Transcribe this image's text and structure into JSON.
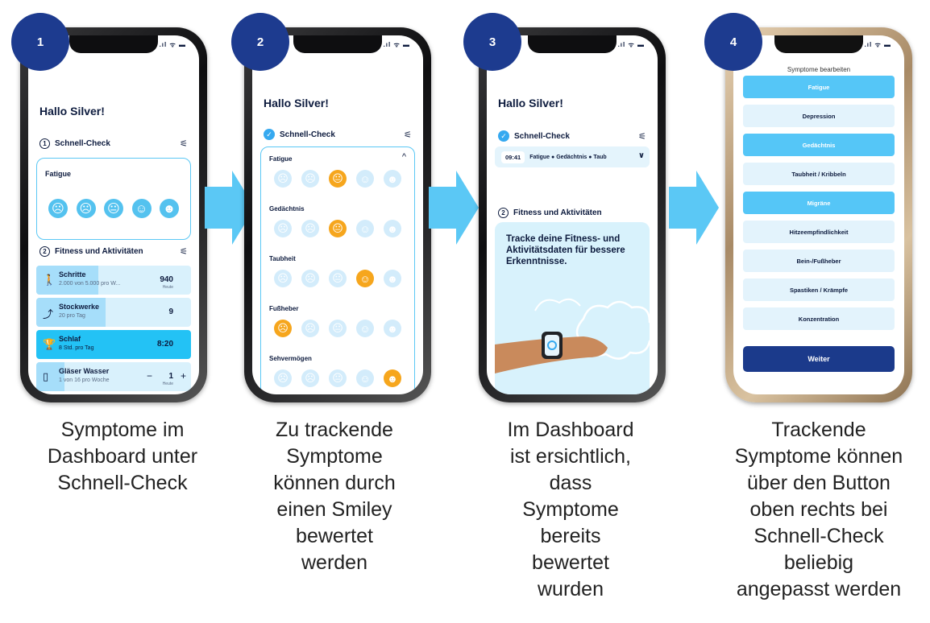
{
  "steps": [
    {
      "number": "1",
      "caption": "Symptome im\nDashboard unter\nSchnell-Check"
    },
    {
      "number": "2",
      "caption": "Zu trackende\nSymptome\nkönnen durch\neinen Smiley\nbewertet\nwerden"
    },
    {
      "number": "3",
      "caption": "Im Dashboard\nist ersichtlich,\ndass\nSymptome\nbereits\nbewertet\nwurden"
    },
    {
      "number": "4",
      "caption": "Trackende\nSymptome können\nüber den Button\noben rechts bei\nSchnell-Check\nbeliebig\nangepasst werden"
    }
  ],
  "phone1": {
    "greeting": "Hallo Silver!",
    "quick_check_title": "Schnell-Check",
    "symptom_label": "Fatigue",
    "activities_title": "Fitness und Aktivitäten",
    "activities": [
      {
        "title": "Schritte",
        "subtitle": "2.000 von 5.000 pro W...",
        "value": "940",
        "hint": "Heute",
        "icon": "walking-icon",
        "progress": 0.4
      },
      {
        "title": "Stockwerke",
        "subtitle": "20 pro Tag",
        "value": "9",
        "hint": "",
        "icon": "stairs-icon",
        "progress": 0.45
      },
      {
        "title": "Schlaf",
        "subtitle": "8 Std. pro Tag",
        "value": "8:20",
        "hint": "",
        "icon": "trophy-icon",
        "progress": 1.0
      },
      {
        "title": "Gläser Wasser",
        "subtitle": "1 von 16 pro Woche",
        "value": "1",
        "hint": "Heute",
        "icon": "glass-icon",
        "progress": 0.18
      }
    ],
    "minus": "−",
    "plus": "+"
  },
  "phone2": {
    "greeting": "Hallo Silver!",
    "quick_check_title": "Schnell-Check",
    "symptoms": [
      {
        "label": "Fatigue",
        "selected": 2
      },
      {
        "label": "Gedächtnis",
        "selected": 2
      },
      {
        "label": "Taubheit",
        "selected": 3
      },
      {
        "label": "Fußheber",
        "selected": 0
      },
      {
        "label": "Sehvermögen",
        "selected": 4
      }
    ]
  },
  "phone3": {
    "greeting": "Hallo Silver!",
    "quick_check_title": "Schnell-Check",
    "time": "09:41",
    "summary": "Fatigue ● Gedächtnis ● Taub",
    "activities_title": "Fitness und Aktivitäten",
    "promo_text": "Tracke deine Fitness- und Aktivitätsdaten für bessere Erkenntnisse."
  },
  "phone4": {
    "title": "Symptome bearbeiten",
    "options": [
      {
        "label": "Fatigue",
        "on": true
      },
      {
        "label": "Depression",
        "on": false
      },
      {
        "label": "Gedächtnis",
        "on": true
      },
      {
        "label": "Taubheit / Kribbeln",
        "on": false
      },
      {
        "label": "Migräne",
        "on": true
      },
      {
        "label": "Hitzeempfindlichkeit",
        "on": false
      },
      {
        "label": "Bein-/Fußheber",
        "on": false
      },
      {
        "label": "Spastiken / Krämpfe",
        "on": false
      },
      {
        "label": "Konzentration",
        "on": false
      }
    ],
    "button": "Weiter"
  },
  "status": {
    "signal": ".ıl ᯤ ▬"
  },
  "faces": [
    "☹",
    "☹",
    "😐",
    "☺",
    "☻"
  ],
  "colors": {
    "navy": "#1d3b8f",
    "accent": "#5bc8f5",
    "selected": "#f6a61d"
  }
}
